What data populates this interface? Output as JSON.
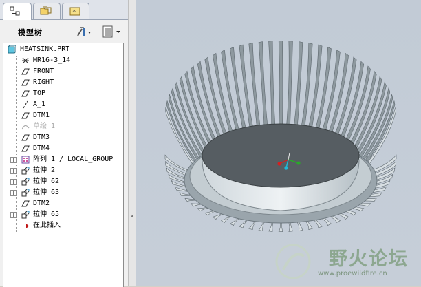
{
  "tabs": [
    {
      "name": "model-tree-tab",
      "active": true
    },
    {
      "name": "folder-browser-tab",
      "active": false
    },
    {
      "name": "favorites-tab",
      "active": false
    }
  ],
  "panel": {
    "title": "模型树"
  },
  "tree": {
    "root": "HEATSINK.PRT",
    "items": [
      {
        "label": "MR16-3_14",
        "icon": "csys-icon",
        "expandable": false
      },
      {
        "label": "FRONT",
        "icon": "datum-plane-icon",
        "expandable": false
      },
      {
        "label": "RIGHT",
        "icon": "datum-plane-icon",
        "expandable": false
      },
      {
        "label": "TOP",
        "icon": "datum-plane-icon",
        "expandable": false
      },
      {
        "label": "A_1",
        "icon": "datum-axis-icon",
        "expandable": false
      },
      {
        "label": "DTM1",
        "icon": "datum-plane-icon",
        "expandable": false
      },
      {
        "label": "草绘 1",
        "icon": "sketch-icon",
        "expandable": false,
        "dim": true
      },
      {
        "label": "DTM3",
        "icon": "datum-plane-icon",
        "expandable": false
      },
      {
        "label": "DTM4",
        "icon": "datum-plane-icon",
        "expandable": false
      },
      {
        "label": "阵列 1 / LOCAL_GROUP",
        "icon": "pattern-icon",
        "expandable": true
      },
      {
        "label": "拉伸 2",
        "icon": "extrude-icon",
        "expandable": true
      },
      {
        "label": "拉伸 62",
        "icon": "extrude-icon",
        "expandable": true
      },
      {
        "label": "拉伸 63",
        "icon": "extrude-icon",
        "expandable": true
      },
      {
        "label": "DTM2",
        "icon": "datum-plane-icon",
        "expandable": false
      },
      {
        "label": "拉伸 65",
        "icon": "extrude-icon",
        "expandable": true
      },
      {
        "label": "在此插入",
        "icon": "insert-here-arrow-icon",
        "expandable": false
      }
    ]
  },
  "watermark": {
    "text": "野火论坛",
    "url": "www.proewildfire.cn"
  },
  "colors": {
    "viewport_bg": "#c4ccd6",
    "model": "#b9c3c9",
    "csys_x": "#d42020",
    "csys_y": "#2aa82a",
    "csys_z": "#20b8d8"
  }
}
